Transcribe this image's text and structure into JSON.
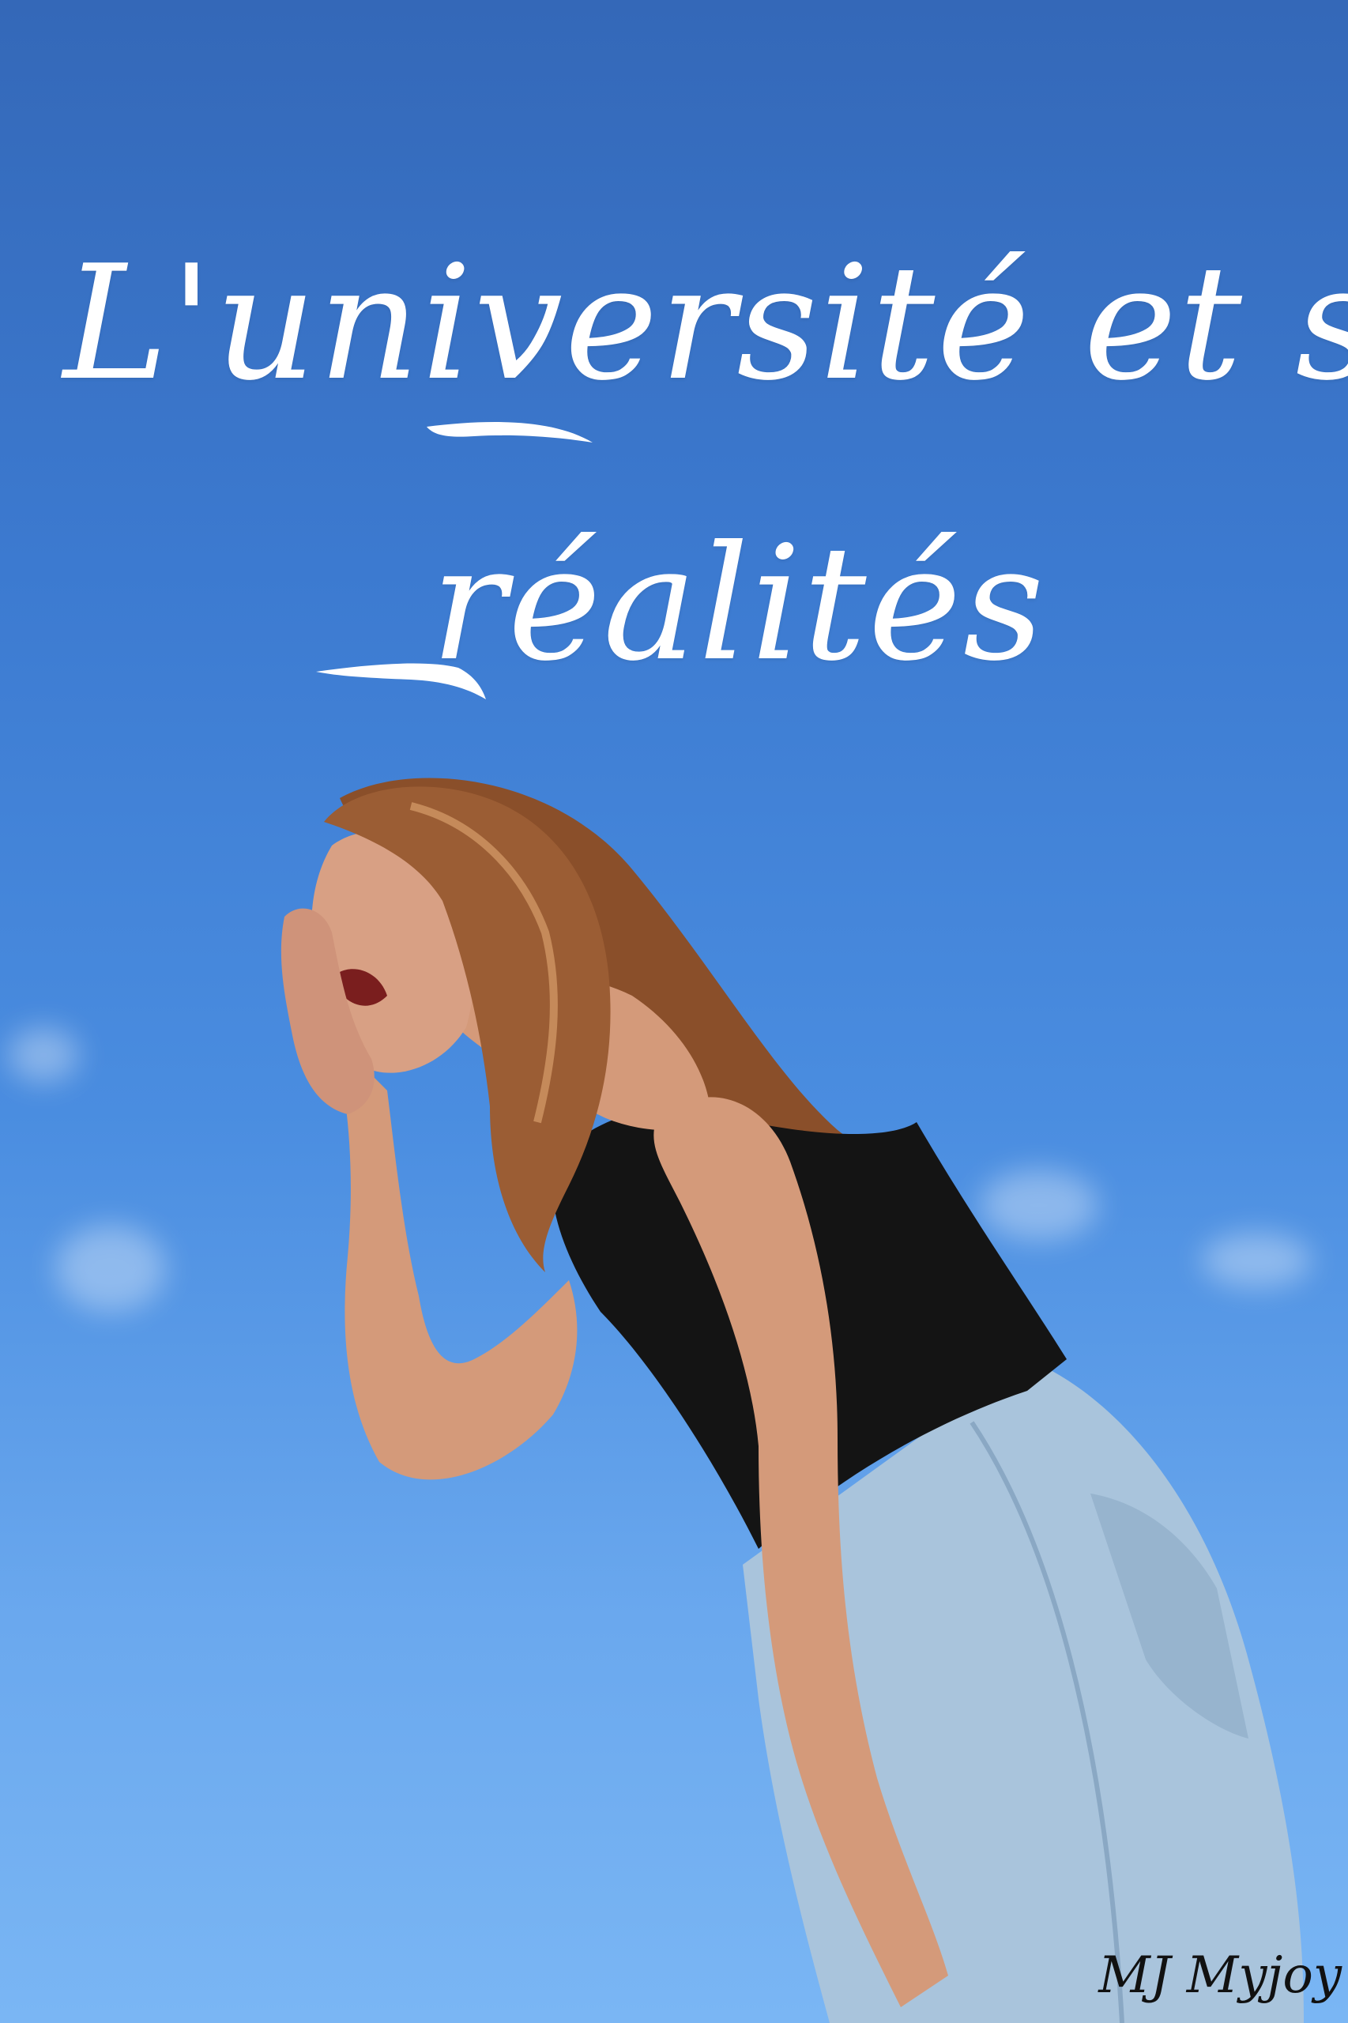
{
  "title": {
    "line1": "L'université et ses",
    "line2": "réalités"
  },
  "signature": "MJ Myjoy",
  "colors": {
    "sky_top": "#3468b8",
    "sky_bottom": "#7ab6f4",
    "title_text": "#ffffff",
    "top_garment": "#141414",
    "jeans": "#a9c4dc",
    "hair": "#8a4f2a",
    "skin": "#d49a7a"
  }
}
